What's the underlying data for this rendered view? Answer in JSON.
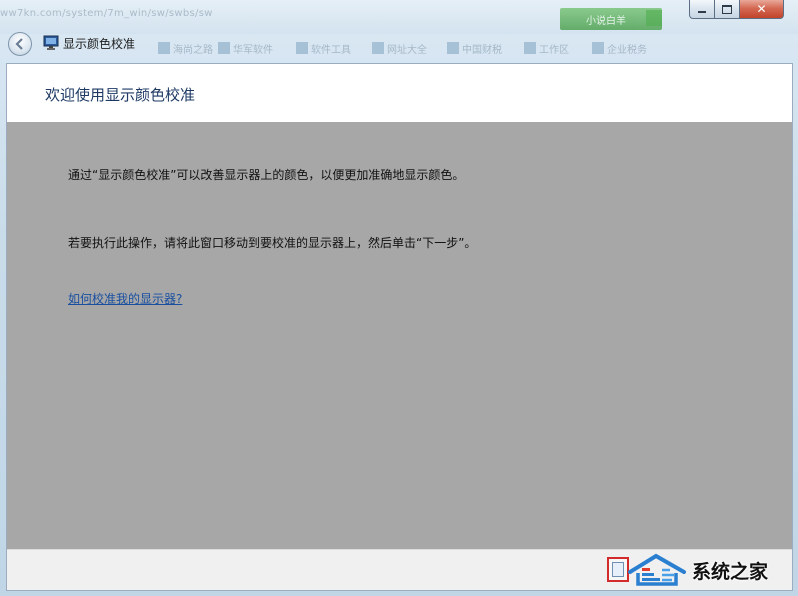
{
  "background": {
    "url_fragment": "ww7kn.com/system/7m_win/sw/swbs/sw",
    "green_button_label": "小说白羊",
    "bookmarks": [
      "海尚之路",
      "华军软件",
      "软件工具",
      "网址大全",
      "中国财税",
      "工作区",
      "企业税务"
    ]
  },
  "window": {
    "app_title": "显示颜色校准",
    "caption": {
      "minimize_icon": "minimize-icon",
      "maximize_icon": "maximize-icon",
      "close_symbol": "✕"
    }
  },
  "page": {
    "title": "欢迎使用显示颜色校准",
    "paragraph_1": "通过“显示颜色校准”可以改善显示器上的颜色，以便更加准确地显示颜色。",
    "paragraph_2": "若要执行此操作，请将此窗口移动到要校准的显示器上，然后单击“下一步”。",
    "help_link": "如何校准我的显示器?"
  },
  "watermark": {
    "text": "系统之家"
  },
  "colors": {
    "overlay": "#a7a7a7",
    "title": "#1e3a64",
    "link": "#1a4fa0",
    "highlight": "#d12b2b"
  }
}
